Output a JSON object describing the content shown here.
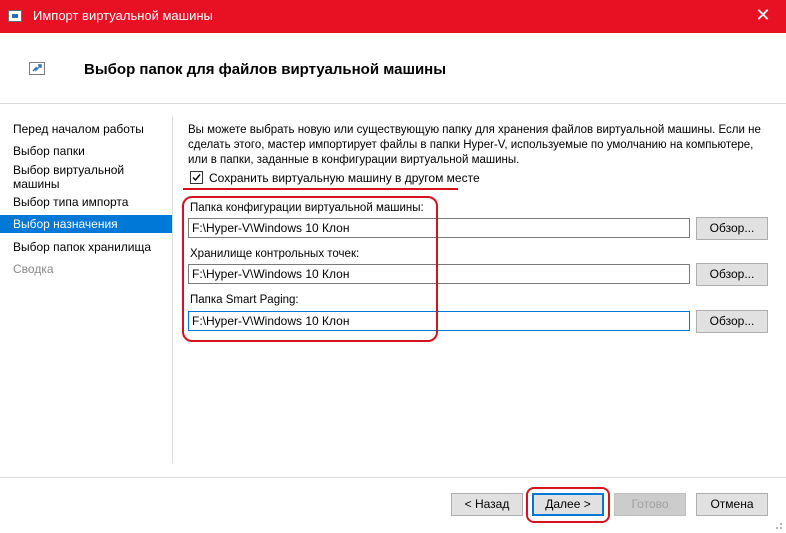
{
  "window": {
    "title": "Импорт виртуальной машины",
    "close_glyph": "✕"
  },
  "header": {
    "title": "Выбор папок для файлов виртуальной машины",
    "icon": "wizard-icon"
  },
  "nav": {
    "items": [
      {
        "label": "Перед началом работы",
        "state": "normal"
      },
      {
        "label": "Выбор папки",
        "state": "normal"
      },
      {
        "label": "Выбор виртуальной",
        "label2": "машины",
        "state": "normal"
      },
      {
        "label": "Выбор типа импорта",
        "state": "normal"
      },
      {
        "label": "Выбор назначения",
        "state": "active"
      },
      {
        "label": "Выбор папок хранилища",
        "state": "normal"
      },
      {
        "label": "Сводка",
        "state": "disabled"
      }
    ]
  },
  "main": {
    "description": "Вы можете выбрать новую или существующую папку для хранения файлов виртуальной машины. Если не сделать этого, мастер импортирует файлы в папки Hyper-V, используемые по умолчанию на компьютере, или в папки, заданные в конфигурации виртуальной машины.",
    "checkbox": {
      "label": "Сохранить виртуальную машину в другом месте",
      "checked": true
    },
    "fields": [
      {
        "label": "Папка конфигурации виртуальной машины:",
        "value": "F:\\Hyper-V\\Windows 10 Клон",
        "browse": "Обзор..."
      },
      {
        "label": "Хранилище контрольных точек:",
        "value": "F:\\Hyper-V\\Windows 10 Клон",
        "browse": "Обзор..."
      },
      {
        "label": "Папка Smart Paging:",
        "value": "F:\\Hyper-V\\Windows 10 Клон",
        "browse": "Обзор..."
      }
    ]
  },
  "footer": {
    "back": "< Назад",
    "next": "Далее >",
    "finish": "Готово",
    "cancel": "Отмена"
  },
  "colors": {
    "titlebar": "#e81123",
    "accent": "#0078d7",
    "annotation": "#d7121f"
  }
}
